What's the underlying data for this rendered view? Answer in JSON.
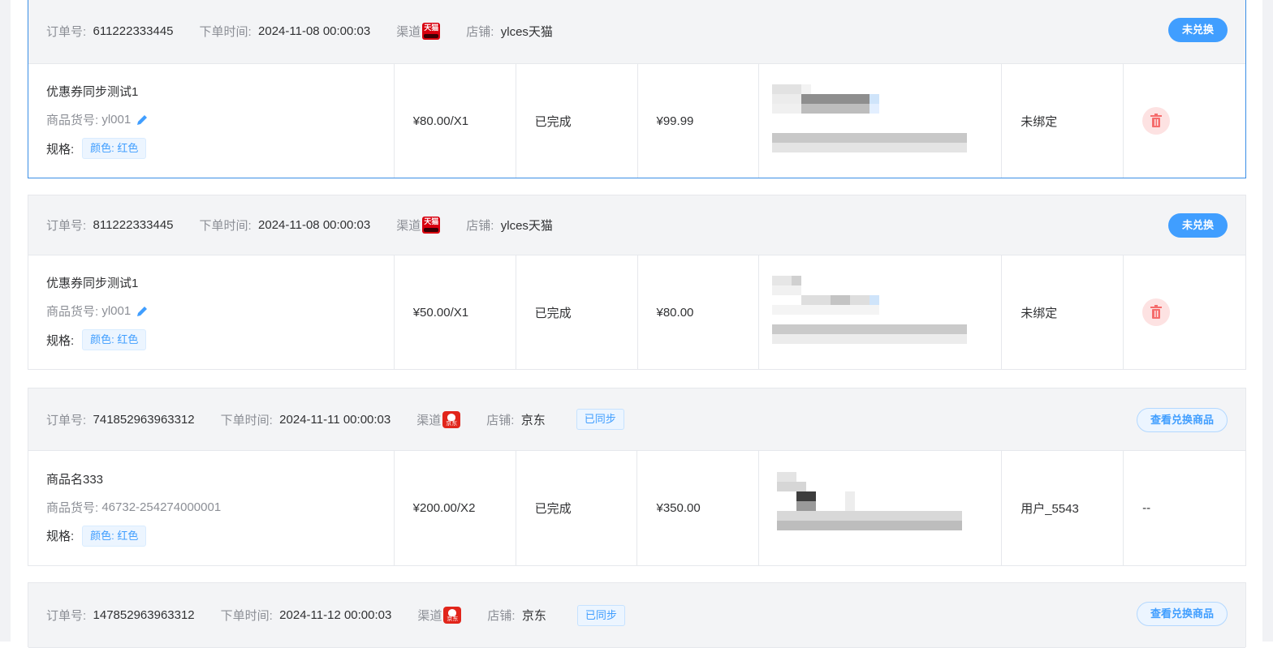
{
  "labels": {
    "order_no": "订单号:",
    "order_time": "下单时间:",
    "channel": "渠道",
    "store": "店铺:",
    "sku": "商品货号:",
    "spec": "规格:"
  },
  "orders": [
    {
      "order_no": "611222333445",
      "order_time": "2024-11-08 00:00:03",
      "channel_icon": "tmall-icon",
      "channel_icon_text": "天猫",
      "store": "ylces天猫",
      "action": "未兑换",
      "product_name": "优惠券同步测试1",
      "sku": "yl001",
      "spec": "颜色: 红色",
      "price": "¥80.00/X1",
      "status": "已完成",
      "paid": "¥99.99",
      "bind": "未绑定",
      "op": "trash-icon"
    },
    {
      "order_no": "811222333445",
      "order_time": "2024-11-08 00:00:03",
      "channel_icon": "tmall-icon",
      "channel_icon_text": "天猫",
      "store": "ylces天猫",
      "action": "未兑换",
      "product_name": "优惠券同步测试1",
      "sku": "yl001",
      "spec": "颜色: 红色",
      "price": "¥50.00/X1",
      "status": "已完成",
      "paid": "¥80.00",
      "bind": "未绑定",
      "op": "trash-icon"
    },
    {
      "order_no": "741852963963312",
      "order_time": "2024-11-11 00:00:03",
      "channel_icon": "jd-icon",
      "channel_icon_text": "京东",
      "store": "京东",
      "sync": "已同步",
      "action": "查看兑换商品",
      "product_name": "商品名333",
      "sku": "46732-254274000001",
      "spec": "颜色: 红色",
      "price": "¥200.00/X2",
      "status": "已完成",
      "paid": "¥350.00",
      "bind": "用户_5543",
      "op": "--"
    },
    {
      "order_no": "147852963963312",
      "order_time": "2024-11-12 00:00:03",
      "channel_icon": "jd-icon",
      "channel_icon_text": "京东",
      "store": "京东",
      "sync": "已同步",
      "action": "查看兑换商品"
    }
  ],
  "colors": {
    "primary": "#409eff",
    "header_bg": "#f3f4f6",
    "danger_bg": "#fde2e2",
    "danger": "#f56c6c"
  }
}
